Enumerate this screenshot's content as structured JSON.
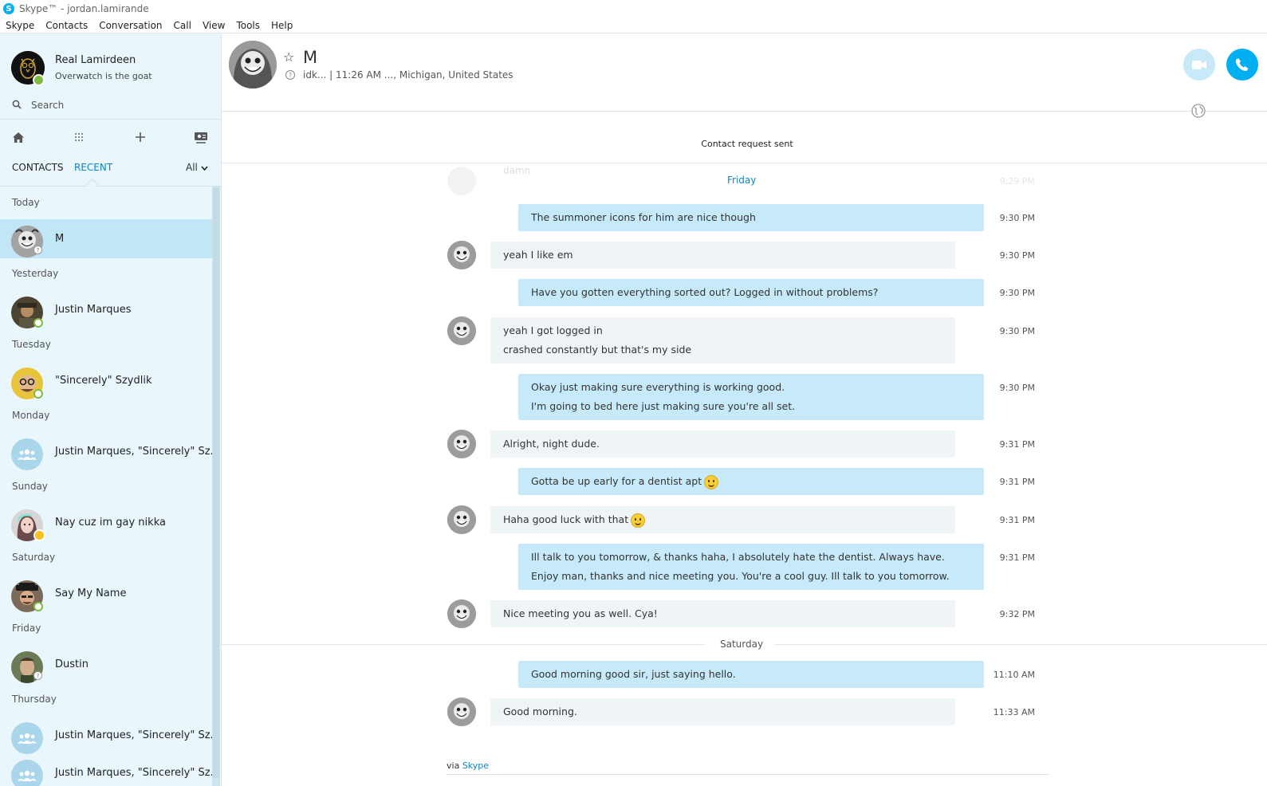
{
  "window": {
    "title": "Skype™ - jordan.lamirande",
    "logo_letter": "S"
  },
  "menu": [
    "Skype",
    "Contacts",
    "Conversation",
    "Call",
    "View",
    "Tools",
    "Help"
  ],
  "profile": {
    "name": "Real Lamirdeen",
    "mood": "Overwatch is the goat"
  },
  "search": {
    "placeholder": "Search",
    "value": ""
  },
  "tabs": {
    "contacts": "CONTACTS",
    "recent": "RECENT",
    "filter": "All"
  },
  "recent": [
    {
      "group": "Today",
      "contacts": [
        {
          "name": "M",
          "status": "unknown",
          "selected": true
        }
      ]
    },
    {
      "group": "Yesterday",
      "contacts": [
        {
          "name": "Justin Marques",
          "status": "online"
        }
      ]
    },
    {
      "group": "Tuesday",
      "contacts": [
        {
          "name": "\"Sincerely\" Szydlik",
          "status": "online"
        }
      ]
    },
    {
      "group": "Monday",
      "contacts": [
        {
          "name": "Justin Marques, \"Sincerely\" Sz...",
          "status": "group"
        }
      ]
    },
    {
      "group": "Sunday",
      "contacts": [
        {
          "name": "Nay cuz im gay nikka",
          "status": "away"
        }
      ]
    },
    {
      "group": "Saturday",
      "contacts": [
        {
          "name": "Say My Name",
          "status": "online"
        }
      ]
    },
    {
      "group": "Friday",
      "contacts": [
        {
          "name": "Dustin",
          "status": "unknown"
        }
      ]
    },
    {
      "group": "Thursday",
      "contacts": [
        {
          "name": "Justin Marques, \"Sincerely\" Sz...",
          "status": "group"
        },
        {
          "name": "Justin Marques, \"Sincerely\" Sz...",
          "status": "group"
        }
      ]
    }
  ],
  "conversation": {
    "name": "M",
    "info": "idk...  |  11:26 AM ..., Michigan, United States",
    "contact_request": "Contact request sent",
    "faded_text": "damn",
    "faded_time": "9:29 PM",
    "days": [
      {
        "label": "Friday",
        "messages": [
          {
            "dir": "out",
            "lines": [
              "The summoner icons for him are nice though"
            ],
            "time": "9:30 PM"
          },
          {
            "dir": "in",
            "lines": [
              "yeah I like em"
            ],
            "time": "9:30 PM"
          },
          {
            "dir": "out",
            "lines": [
              "Have you gotten everything sorted out? Logged in without problems?"
            ],
            "time": "9:30 PM"
          },
          {
            "dir": "in",
            "lines": [
              "yeah I got logged in",
              "crashed constantly but that's my side"
            ],
            "time": "9:30 PM"
          },
          {
            "dir": "out",
            "lines": [
              "Okay just making sure everything is working good.",
              "I'm going to bed here just making sure you're all set."
            ],
            "time": "9:30 PM"
          },
          {
            "dir": "in",
            "lines": [
              "Alright, night dude."
            ],
            "time": "9:31 PM"
          },
          {
            "dir": "out",
            "lines": [
              "Gotta be up early for a dentist apt"
            ],
            "time": "9:31 PM",
            "emoji": true
          },
          {
            "dir": "in",
            "lines": [
              "Haha good luck with that"
            ],
            "time": "9:31 PM",
            "emoji": true
          },
          {
            "dir": "out",
            "lines": [
              "Ill talk to you tomorrow, & thanks haha, I absolutely hate the dentist. Always have.",
              "Enjoy man, thanks and nice meeting you. You're a cool guy. Ill talk to you tomorrow."
            ],
            "time": "9:31 PM"
          },
          {
            "dir": "in",
            "lines": [
              "Nice meeting you as well. Cya!"
            ],
            "time": "9:32 PM"
          }
        ]
      },
      {
        "label": "Saturday",
        "messages": [
          {
            "dir": "out",
            "lines": [
              "Good morning good sir, just saying hello."
            ],
            "time": "11:10 AM"
          },
          {
            "dir": "in",
            "lines": [
              "Good morning."
            ],
            "time": "11:33 AM"
          }
        ]
      }
    ],
    "via": {
      "prefix": "via ",
      "link": "Skype"
    }
  },
  "colors": {
    "accent": "#00aff0",
    "out_bubble": "#c7eafb",
    "in_bubble": "#eff4f7",
    "sidebar": "#e9f6fc",
    "selected": "#c1e7f7",
    "online": "#7dbb42",
    "away": "#f6c120"
  }
}
